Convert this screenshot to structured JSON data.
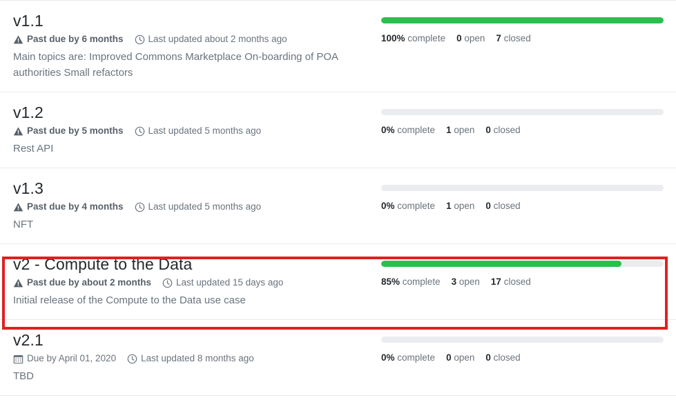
{
  "page": {
    "title": "Milestones list",
    "accent_green": "#2cbe4e",
    "track_gray": "#eaecef",
    "annotation_color": "#e02020"
  },
  "labels": {
    "complete_suffix": "complete",
    "open_label": "open",
    "closed_label": "closed"
  },
  "milestones": [
    {
      "title": "v1.1",
      "due_icon": "alert-triangle-icon",
      "due_text": "Past due by 6 months",
      "overdue": true,
      "updated_icon": "clock-icon",
      "updated_text": "Last updated about 2 months ago",
      "description": "Main topics are: Improved Commons Marketplace On-boarding of POA authorities Small refactors",
      "percent": 100,
      "percent_text": "100%",
      "open": "0",
      "closed": "7",
      "highlighted": false
    },
    {
      "title": "v1.2",
      "due_icon": "alert-triangle-icon",
      "due_text": "Past due by 5 months",
      "overdue": true,
      "updated_icon": "clock-icon",
      "updated_text": "Last updated 5 months ago",
      "description": "Rest API",
      "percent": 0,
      "percent_text": "0%",
      "open": "1",
      "closed": "0",
      "highlighted": false
    },
    {
      "title": "v1.3",
      "due_icon": "alert-triangle-icon",
      "due_text": "Past due by 4 months",
      "overdue": true,
      "updated_icon": "clock-icon",
      "updated_text": "Last updated 5 months ago",
      "description": "NFT",
      "percent": 0,
      "percent_text": "0%",
      "open": "1",
      "closed": "0",
      "highlighted": false
    },
    {
      "title": "v2 - Compute to the Data",
      "due_icon": "alert-triangle-icon",
      "due_text": "Past due by about 2 months",
      "overdue": true,
      "updated_icon": "clock-icon",
      "updated_text": "Last updated 15 days ago",
      "description": "Initial release of the Compute to the Data use case",
      "percent": 85,
      "percent_text": "85%",
      "open": "3",
      "closed": "17",
      "highlighted": true
    },
    {
      "title": "v2.1",
      "due_icon": "calendar-icon",
      "due_text": "Due by April 01, 2020",
      "overdue": false,
      "updated_icon": "clock-icon",
      "updated_text": "Last updated 8 months ago",
      "description": "TBD",
      "percent": 0,
      "percent_text": "0%",
      "open": "0",
      "closed": "0",
      "highlighted": false
    }
  ]
}
